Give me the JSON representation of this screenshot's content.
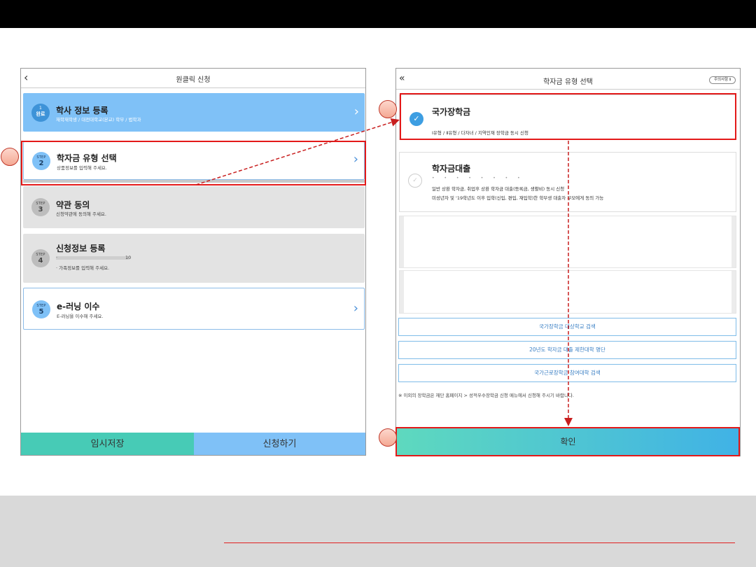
{
  "left_screen": {
    "header": {
      "back_icon": "chevron-left-icon",
      "title": "원클릭 신청"
    },
    "steps": [
      {
        "badge_top": "1",
        "badge_bottom": "완료",
        "title": "학사 정보 등록",
        "subtitle": "재학재학생 / 대전대학교(본교) 학부 / 법학과"
      },
      {
        "badge_top": "STEP",
        "badge_bottom": "2",
        "title": "학자금 유형 선택",
        "subtitle": "상품정보를 입력해 주세요."
      },
      {
        "badge_top": "STEP",
        "badge_bottom": "3",
        "title": "약관 동의",
        "subtitle": "신청약관에 동의해 주세요."
      },
      {
        "badge_top": "STEP",
        "badge_bottom": "4",
        "title": "신청정보 등록",
        "subtitle_1": "·",
        "subtitle_1b": "10",
        "subtitle_2": "· 가족정보를 입력해 주세요."
      },
      {
        "badge_top": "STEP",
        "badge_bottom": "5",
        "title": "e-러닝 이수",
        "subtitle": "E-러닝을 이수해 주세요."
      }
    ],
    "buttons": {
      "save": "임시저장",
      "apply": "신청하기"
    }
  },
  "right_screen": {
    "header": {
      "back_icon": "double-chevron-left-icon",
      "title": "학자금 유형 선택",
      "caution": "주의사항 ℹ"
    },
    "options": [
      {
        "check": "✓",
        "title": "국가장학금",
        "desc": "Ⅰ유형 / Ⅱ유형 / 다자녀 / 지역인재 장학금 동시 신청"
      },
      {
        "check": "✓",
        "title": "학자금대출",
        "dots": "• • • • • • • •",
        "desc_1": "일반 상환 학자금, 취업후 상환 학자금 대출(등록금, 생활비) 동시 신청",
        "desc_2": "미성년자 및 '19학년도 이후 입학(신입, 편입, 재입학)한 학부생 대출자 부모에게 동의 가능"
      }
    ],
    "links": [
      "국가장학금 대상학교 검색",
      "20년도 학자금 대출 제한대학 명단",
      "국가근로장학금 참여대학 검색"
    ],
    "note": "※ 이외의 장학금은 재단 홈페이지 > 성적우수장학금 신청 메뉴에서 신청해 주시기 바랍니다.",
    "confirm": "확인"
  },
  "colors": {
    "highlight_red": "#e31919",
    "blue": "#7fc1f7",
    "teal": "#47cbb6"
  }
}
